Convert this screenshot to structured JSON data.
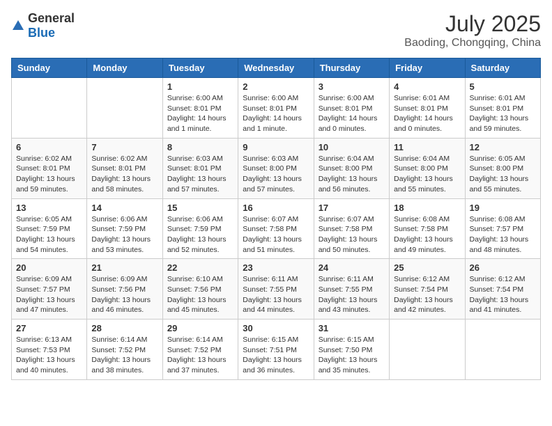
{
  "header": {
    "logo_general": "General",
    "logo_blue": "Blue",
    "month_year": "July 2025",
    "location": "Baoding, Chongqing, China"
  },
  "days_of_week": [
    "Sunday",
    "Monday",
    "Tuesday",
    "Wednesday",
    "Thursday",
    "Friday",
    "Saturday"
  ],
  "weeks": [
    [
      {
        "day": null,
        "sunrise": null,
        "sunset": null,
        "daylight": null
      },
      {
        "day": null,
        "sunrise": null,
        "sunset": null,
        "daylight": null
      },
      {
        "day": "1",
        "sunrise": "Sunrise: 6:00 AM",
        "sunset": "Sunset: 8:01 PM",
        "daylight": "Daylight: 14 hours and 1 minute."
      },
      {
        "day": "2",
        "sunrise": "Sunrise: 6:00 AM",
        "sunset": "Sunset: 8:01 PM",
        "daylight": "Daylight: 14 hours and 1 minute."
      },
      {
        "day": "3",
        "sunrise": "Sunrise: 6:00 AM",
        "sunset": "Sunset: 8:01 PM",
        "daylight": "Daylight: 14 hours and 0 minutes."
      },
      {
        "day": "4",
        "sunrise": "Sunrise: 6:01 AM",
        "sunset": "Sunset: 8:01 PM",
        "daylight": "Daylight: 14 hours and 0 minutes."
      },
      {
        "day": "5",
        "sunrise": "Sunrise: 6:01 AM",
        "sunset": "Sunset: 8:01 PM",
        "daylight": "Daylight: 13 hours and 59 minutes."
      }
    ],
    [
      {
        "day": "6",
        "sunrise": "Sunrise: 6:02 AM",
        "sunset": "Sunset: 8:01 PM",
        "daylight": "Daylight: 13 hours and 59 minutes."
      },
      {
        "day": "7",
        "sunrise": "Sunrise: 6:02 AM",
        "sunset": "Sunset: 8:01 PM",
        "daylight": "Daylight: 13 hours and 58 minutes."
      },
      {
        "day": "8",
        "sunrise": "Sunrise: 6:03 AM",
        "sunset": "Sunset: 8:01 PM",
        "daylight": "Daylight: 13 hours and 57 minutes."
      },
      {
        "day": "9",
        "sunrise": "Sunrise: 6:03 AM",
        "sunset": "Sunset: 8:00 PM",
        "daylight": "Daylight: 13 hours and 57 minutes."
      },
      {
        "day": "10",
        "sunrise": "Sunrise: 6:04 AM",
        "sunset": "Sunset: 8:00 PM",
        "daylight": "Daylight: 13 hours and 56 minutes."
      },
      {
        "day": "11",
        "sunrise": "Sunrise: 6:04 AM",
        "sunset": "Sunset: 8:00 PM",
        "daylight": "Daylight: 13 hours and 55 minutes."
      },
      {
        "day": "12",
        "sunrise": "Sunrise: 6:05 AM",
        "sunset": "Sunset: 8:00 PM",
        "daylight": "Daylight: 13 hours and 55 minutes."
      }
    ],
    [
      {
        "day": "13",
        "sunrise": "Sunrise: 6:05 AM",
        "sunset": "Sunset: 7:59 PM",
        "daylight": "Daylight: 13 hours and 54 minutes."
      },
      {
        "day": "14",
        "sunrise": "Sunrise: 6:06 AM",
        "sunset": "Sunset: 7:59 PM",
        "daylight": "Daylight: 13 hours and 53 minutes."
      },
      {
        "day": "15",
        "sunrise": "Sunrise: 6:06 AM",
        "sunset": "Sunset: 7:59 PM",
        "daylight": "Daylight: 13 hours and 52 minutes."
      },
      {
        "day": "16",
        "sunrise": "Sunrise: 6:07 AM",
        "sunset": "Sunset: 7:58 PM",
        "daylight": "Daylight: 13 hours and 51 minutes."
      },
      {
        "day": "17",
        "sunrise": "Sunrise: 6:07 AM",
        "sunset": "Sunset: 7:58 PM",
        "daylight": "Daylight: 13 hours and 50 minutes."
      },
      {
        "day": "18",
        "sunrise": "Sunrise: 6:08 AM",
        "sunset": "Sunset: 7:58 PM",
        "daylight": "Daylight: 13 hours and 49 minutes."
      },
      {
        "day": "19",
        "sunrise": "Sunrise: 6:08 AM",
        "sunset": "Sunset: 7:57 PM",
        "daylight": "Daylight: 13 hours and 48 minutes."
      }
    ],
    [
      {
        "day": "20",
        "sunrise": "Sunrise: 6:09 AM",
        "sunset": "Sunset: 7:57 PM",
        "daylight": "Daylight: 13 hours and 47 minutes."
      },
      {
        "day": "21",
        "sunrise": "Sunrise: 6:09 AM",
        "sunset": "Sunset: 7:56 PM",
        "daylight": "Daylight: 13 hours and 46 minutes."
      },
      {
        "day": "22",
        "sunrise": "Sunrise: 6:10 AM",
        "sunset": "Sunset: 7:56 PM",
        "daylight": "Daylight: 13 hours and 45 minutes."
      },
      {
        "day": "23",
        "sunrise": "Sunrise: 6:11 AM",
        "sunset": "Sunset: 7:55 PM",
        "daylight": "Daylight: 13 hours and 44 minutes."
      },
      {
        "day": "24",
        "sunrise": "Sunrise: 6:11 AM",
        "sunset": "Sunset: 7:55 PM",
        "daylight": "Daylight: 13 hours and 43 minutes."
      },
      {
        "day": "25",
        "sunrise": "Sunrise: 6:12 AM",
        "sunset": "Sunset: 7:54 PM",
        "daylight": "Daylight: 13 hours and 42 minutes."
      },
      {
        "day": "26",
        "sunrise": "Sunrise: 6:12 AM",
        "sunset": "Sunset: 7:54 PM",
        "daylight": "Daylight: 13 hours and 41 minutes."
      }
    ],
    [
      {
        "day": "27",
        "sunrise": "Sunrise: 6:13 AM",
        "sunset": "Sunset: 7:53 PM",
        "daylight": "Daylight: 13 hours and 40 minutes."
      },
      {
        "day": "28",
        "sunrise": "Sunrise: 6:14 AM",
        "sunset": "Sunset: 7:52 PM",
        "daylight": "Daylight: 13 hours and 38 minutes."
      },
      {
        "day": "29",
        "sunrise": "Sunrise: 6:14 AM",
        "sunset": "Sunset: 7:52 PM",
        "daylight": "Daylight: 13 hours and 37 minutes."
      },
      {
        "day": "30",
        "sunrise": "Sunrise: 6:15 AM",
        "sunset": "Sunset: 7:51 PM",
        "daylight": "Daylight: 13 hours and 36 minutes."
      },
      {
        "day": "31",
        "sunrise": "Sunrise: 6:15 AM",
        "sunset": "Sunset: 7:50 PM",
        "daylight": "Daylight: 13 hours and 35 minutes."
      },
      {
        "day": null,
        "sunrise": null,
        "sunset": null,
        "daylight": null
      },
      {
        "day": null,
        "sunrise": null,
        "sunset": null,
        "daylight": null
      }
    ]
  ]
}
